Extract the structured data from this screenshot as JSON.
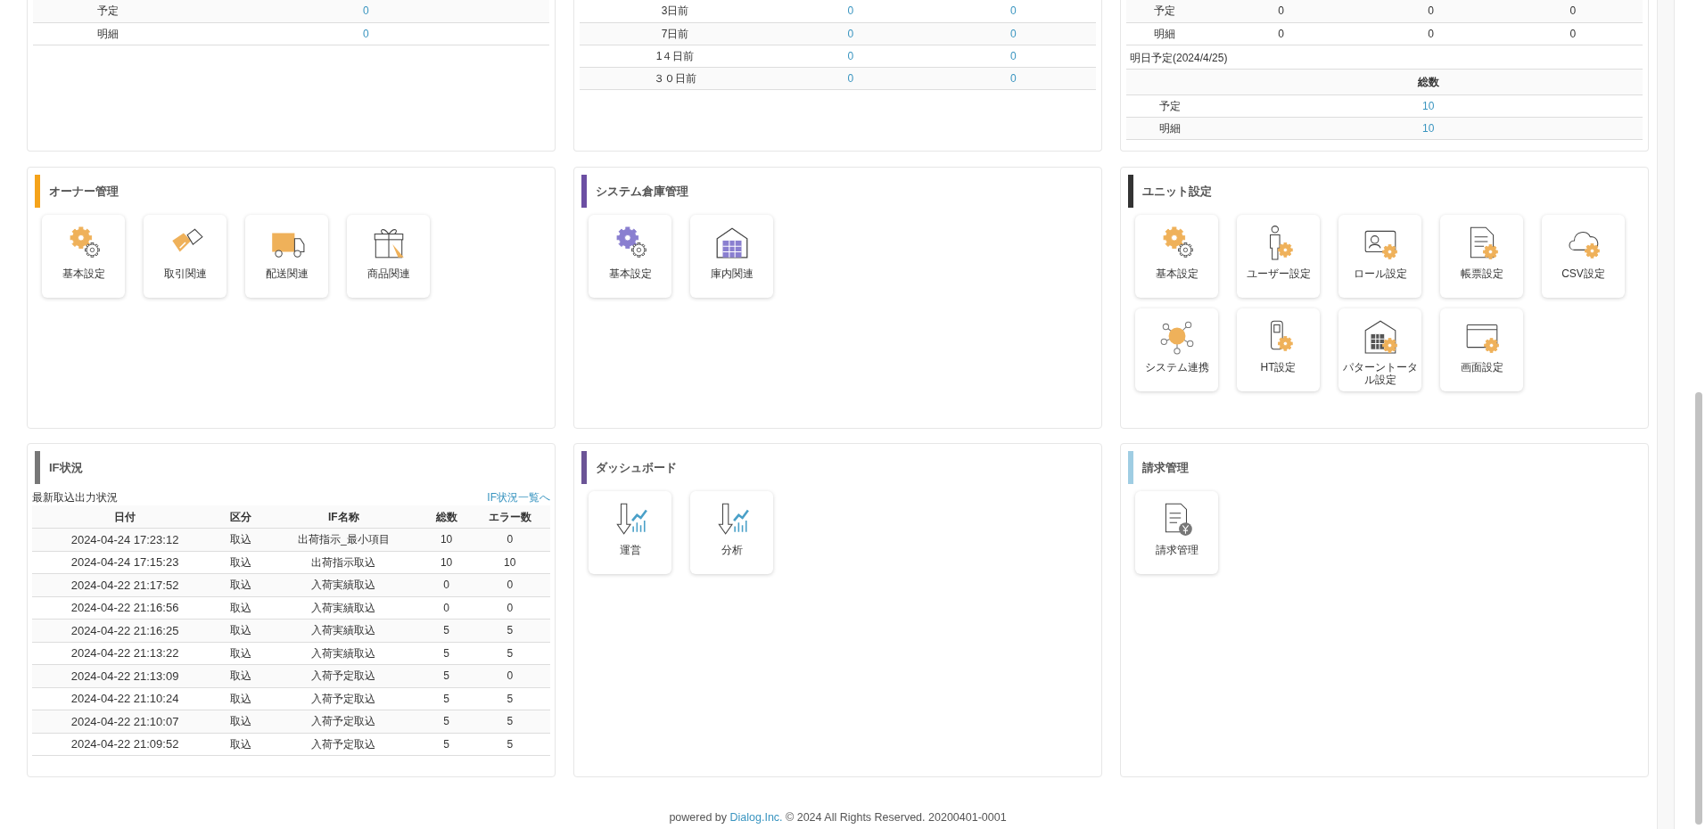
{
  "top_panels": [
    {
      "tables": [
        {
          "rows": [
            {
              "label": "予定",
              "values": [
                {
                  "text": "0",
                  "link": true
                }
              ]
            },
            {
              "label": "明細",
              "values": [
                {
                  "text": "0",
                  "link": true
                }
              ]
            }
          ]
        }
      ]
    },
    {
      "tables": [
        {
          "rows": [
            {
              "label": "3日前",
              "values": [
                {
                  "text": "0",
                  "link": true
                },
                {
                  "text": "0",
                  "link": true
                }
              ]
            },
            {
              "label": "7日前",
              "values": [
                {
                  "text": "0",
                  "link": true
                },
                {
                  "text": "0",
                  "link": true
                }
              ]
            },
            {
              "label": "1４日前",
              "values": [
                {
                  "text": "0",
                  "link": true
                },
                {
                  "text": "0",
                  "link": true
                }
              ]
            },
            {
              "label": "３０日前",
              "values": [
                {
                  "text": "0",
                  "link": true
                },
                {
                  "text": "0",
                  "link": true
                }
              ]
            }
          ]
        }
      ]
    },
    {
      "tables": [
        {
          "rows": [
            {
              "label": "予定",
              "values": [
                {
                  "text": "0",
                  "link": false
                },
                {
                  "text": "0",
                  "link": false
                },
                {
                  "text": "0",
                  "link": false
                }
              ]
            },
            {
              "label": "明細",
              "values": [
                {
                  "text": "0",
                  "link": false
                },
                {
                  "text": "0",
                  "link": false
                },
                {
                  "text": "0",
                  "link": false
                }
              ]
            }
          ]
        },
        {
          "caption": "明日予定(2024/4/25)",
          "header_columns": [
            "総数"
          ],
          "rows": [
            {
              "label": "予定",
              "values": [
                {
                  "text": "10",
                  "link": true
                }
              ]
            },
            {
              "label": "明細",
              "values": [
                {
                  "text": "10",
                  "link": true
                }
              ]
            }
          ]
        }
      ]
    }
  ],
  "panels": [
    {
      "kind": "menu",
      "title": "オーナー管理",
      "color": "#f5a31a",
      "tiles": [
        {
          "label": "基本設定",
          "kind": "gear"
        },
        {
          "label": "取引関連",
          "kind": "handshake"
        },
        {
          "label": "配送関連",
          "kind": "truck"
        },
        {
          "label": "商品関連",
          "kind": "gift"
        }
      ]
    },
    {
      "kind": "menu",
      "title": "システム倉庫管理",
      "color": "#6c4fa3",
      "tiles": [
        {
          "label": "基本設定",
          "kind": "gear-purple"
        },
        {
          "label": "庫内関連",
          "kind": "warehouse"
        }
      ]
    },
    {
      "kind": "menu",
      "title": "ユニット設定",
      "color": "#333333",
      "tiles": [
        {
          "label": "基本設定",
          "kind": "gear"
        },
        {
          "label": "ユーザー設定",
          "kind": "person"
        },
        {
          "label": "ロール設定",
          "kind": "idcard"
        },
        {
          "label": "帳票設定",
          "kind": "document"
        },
        {
          "label": "CSV設定",
          "kind": "cloud"
        },
        {
          "label": "システム連携",
          "kind": "network"
        },
        {
          "label": "HT設定",
          "kind": "handheld"
        },
        {
          "label": "パターントータル設定",
          "kind": "building"
        },
        {
          "label": "画面設定",
          "kind": "window"
        }
      ]
    },
    {
      "kind": "if_status",
      "title": "IF状況",
      "color": "#777777",
      "caption": "最新取込出力状況",
      "link": "IF状況一覧へ",
      "columns": [
        "日付",
        "区分",
        "IF名称",
        "総数",
        "エラー数"
      ],
      "rows": [
        [
          "2024-04-24 17:23:12",
          "取込",
          "出荷指示_最小項目",
          "10",
          "0"
        ],
        [
          "2024-04-24 17:15:23",
          "取込",
          "出荷指示取込",
          "10",
          "10"
        ],
        [
          "2024-04-22 21:17:52",
          "取込",
          "入荷実績取込",
          "0",
          "0"
        ],
        [
          "2024-04-22 21:16:56",
          "取込",
          "入荷実績取込",
          "0",
          "0"
        ],
        [
          "2024-04-22 21:16:25",
          "取込",
          "入荷実績取込",
          "5",
          "5"
        ],
        [
          "2024-04-22 21:13:22",
          "取込",
          "入荷実績取込",
          "5",
          "5"
        ],
        [
          "2024-04-22 21:13:09",
          "取込",
          "入荷予定取込",
          "5",
          "0"
        ],
        [
          "2024-04-22 21:10:24",
          "取込",
          "入荷予定取込",
          "5",
          "5"
        ],
        [
          "2024-04-22 21:10:07",
          "取込",
          "入荷予定取込",
          "5",
          "5"
        ],
        [
          "2024-04-22 21:09:52",
          "取込",
          "入荷予定取込",
          "5",
          "5"
        ]
      ]
    },
    {
      "kind": "menu",
      "title": "ダッシュボード",
      "color": "#6b5496",
      "tiles": [
        {
          "label": "運営",
          "kind": "chart"
        },
        {
          "label": "分析",
          "kind": "chart"
        }
      ]
    },
    {
      "kind": "menu",
      "title": "請求管理",
      "color": "#9fcde3",
      "tiles": [
        {
          "label": "請求管理",
          "kind": "invoice"
        }
      ]
    }
  ],
  "footer": {
    "before": "powered by",
    "link": "Dialog.Inc.",
    "after": "© 2024 All Rights Reserved. 20200401-0001"
  }
}
